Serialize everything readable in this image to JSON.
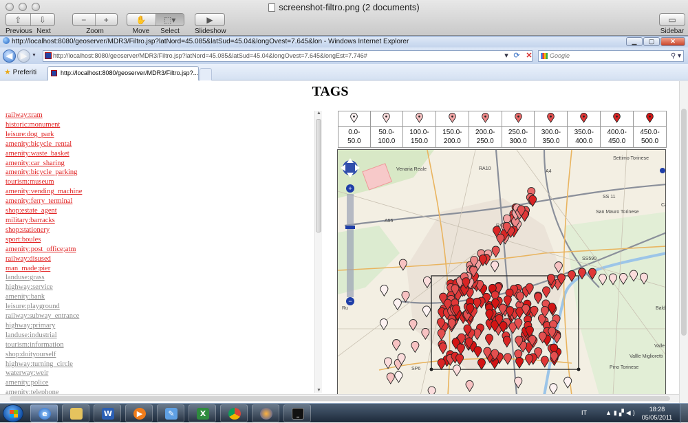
{
  "viewer": {
    "title": "screenshot-filtro.png (2 documents)",
    "toolbar": {
      "previous": "Previous",
      "next": "Next",
      "zoom": "Zoom",
      "move": "Move",
      "select": "Select",
      "slideshow": "Slideshow",
      "sidebar": "Sidebar"
    }
  },
  "browser": {
    "window_title": "http://localhost:8080/geoserver/MDR3/Filtro.jsp?latNord=45.085&latSud=45.04&longOvest=7.645&lon - Windows Internet Explorer",
    "address": "http://localhost:8080/geoserver/MDR3/Filtro.jsp?latNord=45.085&latSud=45.04&longOvest=7.645&longEst=7.746#",
    "search_placeholder": "Google",
    "favorites_label": "Preferiti",
    "tab_title": "http://localhost:8080/geoserver/MDR3/Filtro.jsp?..."
  },
  "page": {
    "title": "TAGS",
    "tags": [
      {
        "label": "railway:tram",
        "color": "red"
      },
      {
        "label": "historic:monument",
        "color": "red"
      },
      {
        "label": "leisure:dog_park",
        "color": "red"
      },
      {
        "label": "amenity:bicycle_rental",
        "color": "red"
      },
      {
        "label": "amenity:waste_basket",
        "color": "red"
      },
      {
        "label": "amenity:car_sharing",
        "color": "red"
      },
      {
        "label": "amenity:bicycle_parking",
        "color": "red"
      },
      {
        "label": "tourism:museum",
        "color": "red"
      },
      {
        "label": "amenity:vending_machine",
        "color": "red"
      },
      {
        "label": "amenity:ferry_terminal",
        "color": "red"
      },
      {
        "label": "shop:estate_agent",
        "color": "red"
      },
      {
        "label": "military:barracks",
        "color": "red"
      },
      {
        "label": "shop:stationery",
        "color": "red"
      },
      {
        "label": "sport:boules",
        "color": "red"
      },
      {
        "label": "amenity:post_office;atm",
        "color": "red"
      },
      {
        "label": "railway:disused",
        "color": "red"
      },
      {
        "label": "man_made:pier",
        "color": "red"
      },
      {
        "label": "landuse:grass",
        "color": "grey"
      },
      {
        "label": "highway:service",
        "color": "grey"
      },
      {
        "label": "amenity:bank",
        "color": "grey"
      },
      {
        "label": "leisure:playground",
        "color": "grey"
      },
      {
        "label": "railway:subway_entrance",
        "color": "grey"
      },
      {
        "label": "highway:primary",
        "color": "grey"
      },
      {
        "label": "landuse:industrial",
        "color": "grey"
      },
      {
        "label": "tourism:information",
        "color": "grey"
      },
      {
        "label": "shop:doityourself",
        "color": "grey"
      },
      {
        "label": "highway:turning_circle",
        "color": "grey"
      },
      {
        "label": "waterway:weir",
        "color": "grey"
      },
      {
        "label": "amenity:police",
        "color": "grey"
      },
      {
        "label": "amenity:telephone",
        "color": "grey"
      }
    ],
    "legend": [
      {
        "range": "0.0-\n50.0",
        "color": "#fdf2f2"
      },
      {
        "range": "50.0-\n100.0",
        "color": "#fbdcdc"
      },
      {
        "range": "100.0-\n150.0",
        "color": "#f7c2c2"
      },
      {
        "range": "150.0-\n200.0",
        "color": "#f3a6a6"
      },
      {
        "range": "200.0-\n250.0",
        "color": "#ee8888"
      },
      {
        "range": "250.0-\n300.0",
        "color": "#e96a6a"
      },
      {
        "range": "300.0-\n350.0",
        "color": "#e44f4f"
      },
      {
        "range": "350.0-\n400.0",
        "color": "#df3737"
      },
      {
        "range": "400.0-\n450.0",
        "color": "#d92525"
      },
      {
        "range": "450.0-\n500.0",
        "color": "#d31414"
      }
    ],
    "map_labels": [
      "Venaria Reale",
      "RA10",
      "A4",
      "A55",
      "RA10",
      "SS 11",
      "Settimo Torinese",
      "San Mauro Torinese",
      "Castiglione",
      "SS590",
      "SP6",
      "Pino Torinese",
      "Valle Ceppi",
      "Vallle Miglioretti",
      "Baldissero",
      "Ru"
    ]
  },
  "taskbar": {
    "language": "IT",
    "time": "18:28",
    "date": "05/05/2011"
  },
  "colors": {
    "accent_red": "#e02020",
    "visited_grey": "#8a8a8a"
  }
}
